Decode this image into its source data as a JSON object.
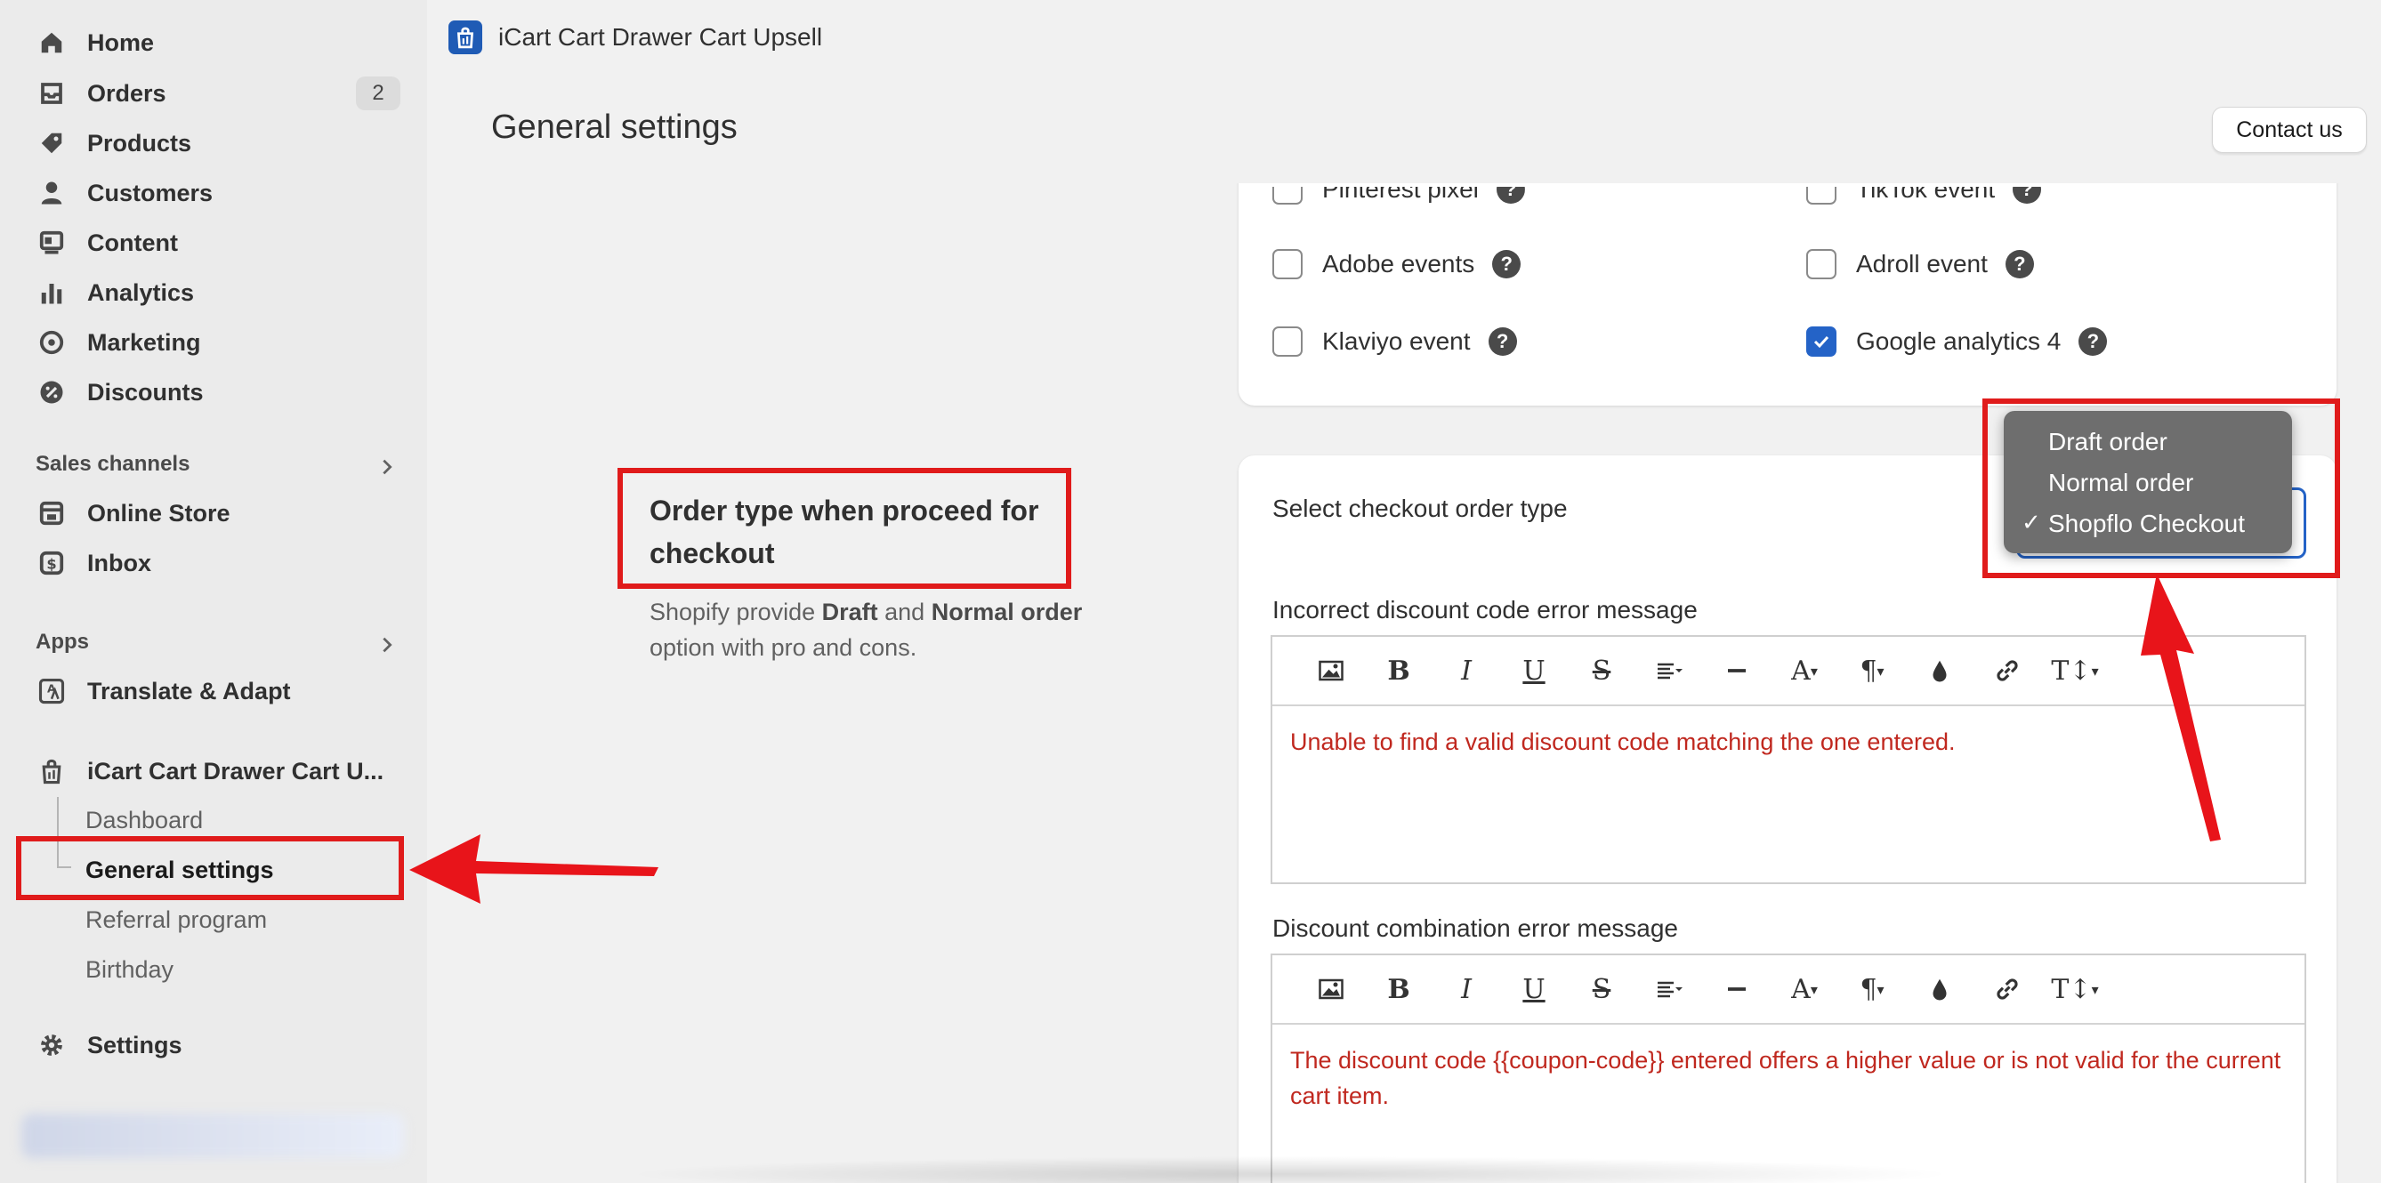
{
  "sidebar": {
    "items": [
      {
        "label": "Home",
        "icon": "home-icon"
      },
      {
        "label": "Orders",
        "icon": "inbox-tray-icon",
        "badge": "2"
      },
      {
        "label": "Products",
        "icon": "tag-icon"
      },
      {
        "label": "Customers",
        "icon": "person-icon"
      },
      {
        "label": "Content",
        "icon": "content-icon"
      },
      {
        "label": "Analytics",
        "icon": "bar-chart-icon"
      },
      {
        "label": "Marketing",
        "icon": "target-icon"
      },
      {
        "label": "Discounts",
        "icon": "discount-icon"
      }
    ],
    "sales_channels": {
      "heading": "Sales channels",
      "items": [
        {
          "label": "Online Store",
          "icon": "storefront-icon"
        },
        {
          "label": "Inbox",
          "icon": "chat-dollar-icon"
        }
      ]
    },
    "apps": {
      "heading": "Apps",
      "items": [
        {
          "label": "Translate & Adapt",
          "icon": "translate-icon"
        },
        {
          "label": "iCart Cart Drawer Cart U...",
          "icon": "icart-bag-icon"
        }
      ],
      "sub_items": [
        "Dashboard",
        "General settings",
        "Referral program",
        "Birthday"
      ],
      "active_sub": "General settings"
    },
    "settings": {
      "label": "Settings",
      "icon": "gear-icon"
    }
  },
  "header": {
    "app_title": "iCart Cart Drawer Cart Upsell",
    "page_title": "General settings",
    "contact_label": "Contact us"
  },
  "tracking": {
    "items": [
      {
        "label": "Pinterest pixel",
        "checked": false
      },
      {
        "label": "TikTok event",
        "checked": false
      },
      {
        "label": "Adobe events",
        "checked": false
      },
      {
        "label": "Adroll event",
        "checked": false
      },
      {
        "label": "Klaviyo event",
        "checked": false
      },
      {
        "label": "Google analytics 4",
        "checked": true
      }
    ],
    "help_glyph": "?"
  },
  "order_type": {
    "heading": "Order type when proceed for checkout",
    "desc_prefix": "Shopify provide ",
    "desc_bold1": "Draft",
    "desc_mid": " and ",
    "desc_bold2": "Normal order",
    "desc_suffix": " option with pro and cons.",
    "select_label": "Select checkout order type",
    "options": [
      "Draft order",
      "Normal order",
      "Shopflo Checkout"
    ],
    "selected": "Shopflo Checkout",
    "check_glyph": "✓"
  },
  "editors": [
    {
      "label": "Incorrect discount code error message",
      "content": "Unable to find a valid discount code matching the one entered."
    },
    {
      "label": "Discount combination error message",
      "content": "The discount code {{coupon-code}} entered offers a higher value or is not valid for the current cart item."
    }
  ],
  "toolbar_glyphs": {
    "bold": "B",
    "italic": "I",
    "underline": "U",
    "strike": "S",
    "font": "A",
    "para": "¶",
    "size": "T↕"
  },
  "colors": {
    "accent": "#2463c7",
    "annotation": "#e01b1b",
    "error_text": "#c0281f"
  }
}
